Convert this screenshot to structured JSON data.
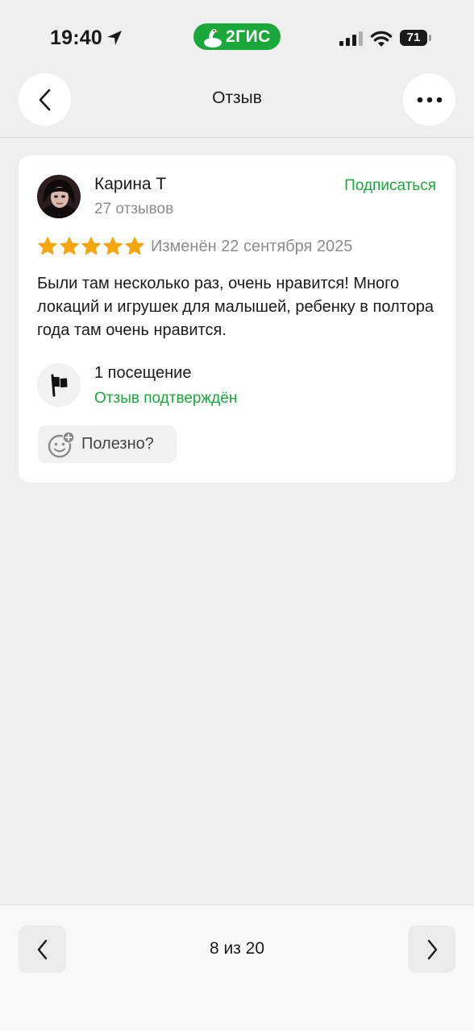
{
  "status_bar": {
    "time": "19:40",
    "brand": "2ГИС",
    "battery": "71",
    "brand_color": "#1aa83a"
  },
  "nav": {
    "title": "Отзыв",
    "back_icon": "chevron-left-icon",
    "more_icon": "more-horizontal-icon"
  },
  "review": {
    "author_name": "Карина Т",
    "author_reviews": "27 отзывов",
    "subscribe_label": "Подписаться",
    "rating": 5,
    "rating_max": 5,
    "star_color": "#f5a60f",
    "edited": "Изменён 22 сентября 2025",
    "text": "Были там несколько раз, очень нравится! Много локаций и игрушек для малышей, ребенку в полтора года там очень нравится.",
    "visits": "1 посещение",
    "verified": "Отзыв подтверждён",
    "helpful_label": "Полезно?"
  },
  "pager": {
    "label": "8 из 20"
  }
}
